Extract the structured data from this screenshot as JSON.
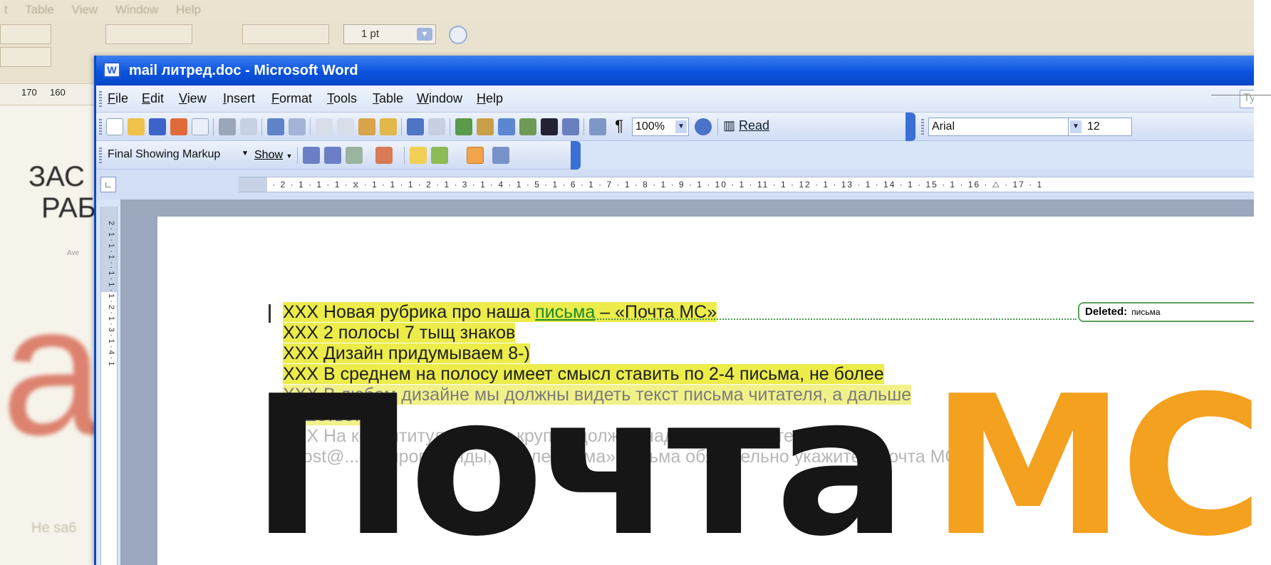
{
  "background": {
    "menu": [
      "t",
      "Table",
      "View",
      "Window",
      "Help"
    ],
    "size_value": "1 pt",
    "ruler_marks": [
      "170",
      "160"
    ],
    "heading_line1": "ЗАС",
    "heading_line2": "РАБ",
    "small_caption": "Ave",
    "big_red": "lar",
    "bottom_text": "He sa6"
  },
  "window": {
    "title": "mail литред.doc - Microsoft Word"
  },
  "menu": {
    "items": [
      "File",
      "Edit",
      "View",
      "Insert",
      "Format",
      "Tools",
      "Table",
      "Window",
      "Help"
    ],
    "type_question": "Type"
  },
  "toolbar": {
    "zoom": "100%",
    "read_label": "Read",
    "font": "Arial",
    "font_size": "12",
    "markup_mode": "Final Showing Markup",
    "show_label": "Show"
  },
  "ruler": {
    "horizontal": "3 · 1 · 2 · 1 · 1 · 1 · ⧖ · 1 · 1 · 1 · 2 · 1 · 3 · 1 · 4 · 1 · 5 · 1 · 6 · 1 · 7 · 1 · 8 · 1 · 9 · 1 · 10 · 1 · 11 · 1 · 12 · 1 · 13 · 1 · 14 · 1 · 15 · 1 · 16 · △ · 17 · 1",
    "vertical": "2 · 1 · 1 · 1 · · 1 · 1 · 1 · 2 · 1 · 3 · 1 · 4 · 1"
  },
  "document": {
    "line1_prefix": "XXX Новая рубрика про наша ",
    "line1_inserted": "письма",
    "line1_suffix": " – «Почта МС»",
    "line2": "XXX 2 полосы 7 тыщ знаков",
    "line3": "XXX Дизайн придумываем 8-)",
    "line4": "XXX В среднем на полосу имеет смысл ставить по 2-4 письма, не более",
    "line5": "XXX В любом дизайне мы должны видеть текст письма читателя, а дальше",
    "line6": "нашответ",
    "line7": "XXX На колонтитуле ярко и крупно должна надпись – пишите нам на",
    "line8": "«post@...» – пропиганды, в поле «тема» письма обязательно укажите «Почта МС»"
  },
  "comment": {
    "label": "Deleted:",
    "text": "письма"
  },
  "headline": {
    "word1": "Почта",
    "word2": "МС"
  },
  "colors": {
    "title_bar": "#0a53df",
    "highlight": "#ecec4a",
    "headline_dark": "#161616",
    "headline_orange": "#f3a11e",
    "inserted_text": "#1a8a2c"
  }
}
